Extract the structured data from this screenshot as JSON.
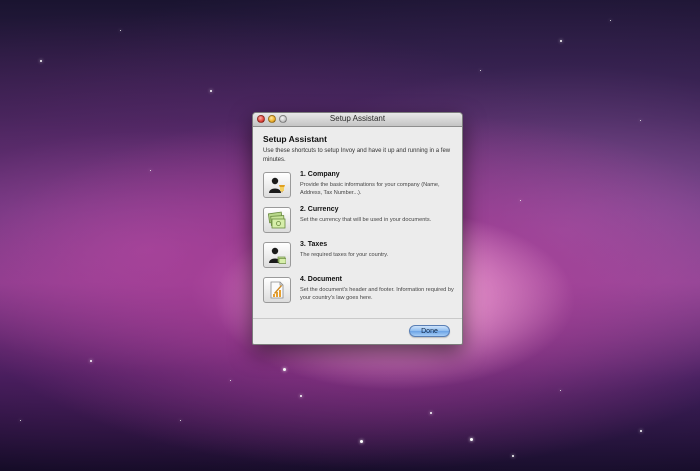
{
  "window": {
    "title": "Setup Assistant"
  },
  "dialog": {
    "heading": "Setup Assistant",
    "intro": "Use these shortcuts to setup Invoy and have it up and running in a few minutes.",
    "items": [
      {
        "icon": "company-person-icon",
        "title": "1. Company",
        "description": "Provide the basic informations for your company (Name, Address, Tax Number...)."
      },
      {
        "icon": "currency-bills-icon",
        "title": "2. Currency",
        "description": "Set the currency that will be used in your documents."
      },
      {
        "icon": "taxes-person-icon",
        "title": "3. Taxes",
        "description": "The required taxes for your country."
      },
      {
        "icon": "document-pencil-icon",
        "title": "4. Document",
        "description": "Set the document's header and footer. Information required by your country's law goes here."
      }
    ],
    "done_label": "Done"
  },
  "colors": {
    "accent_button": "#6ba3e6",
    "close_button": "#e0443a",
    "minimize_button": "#efb02a",
    "zoom_button": "#c8c8c8"
  }
}
